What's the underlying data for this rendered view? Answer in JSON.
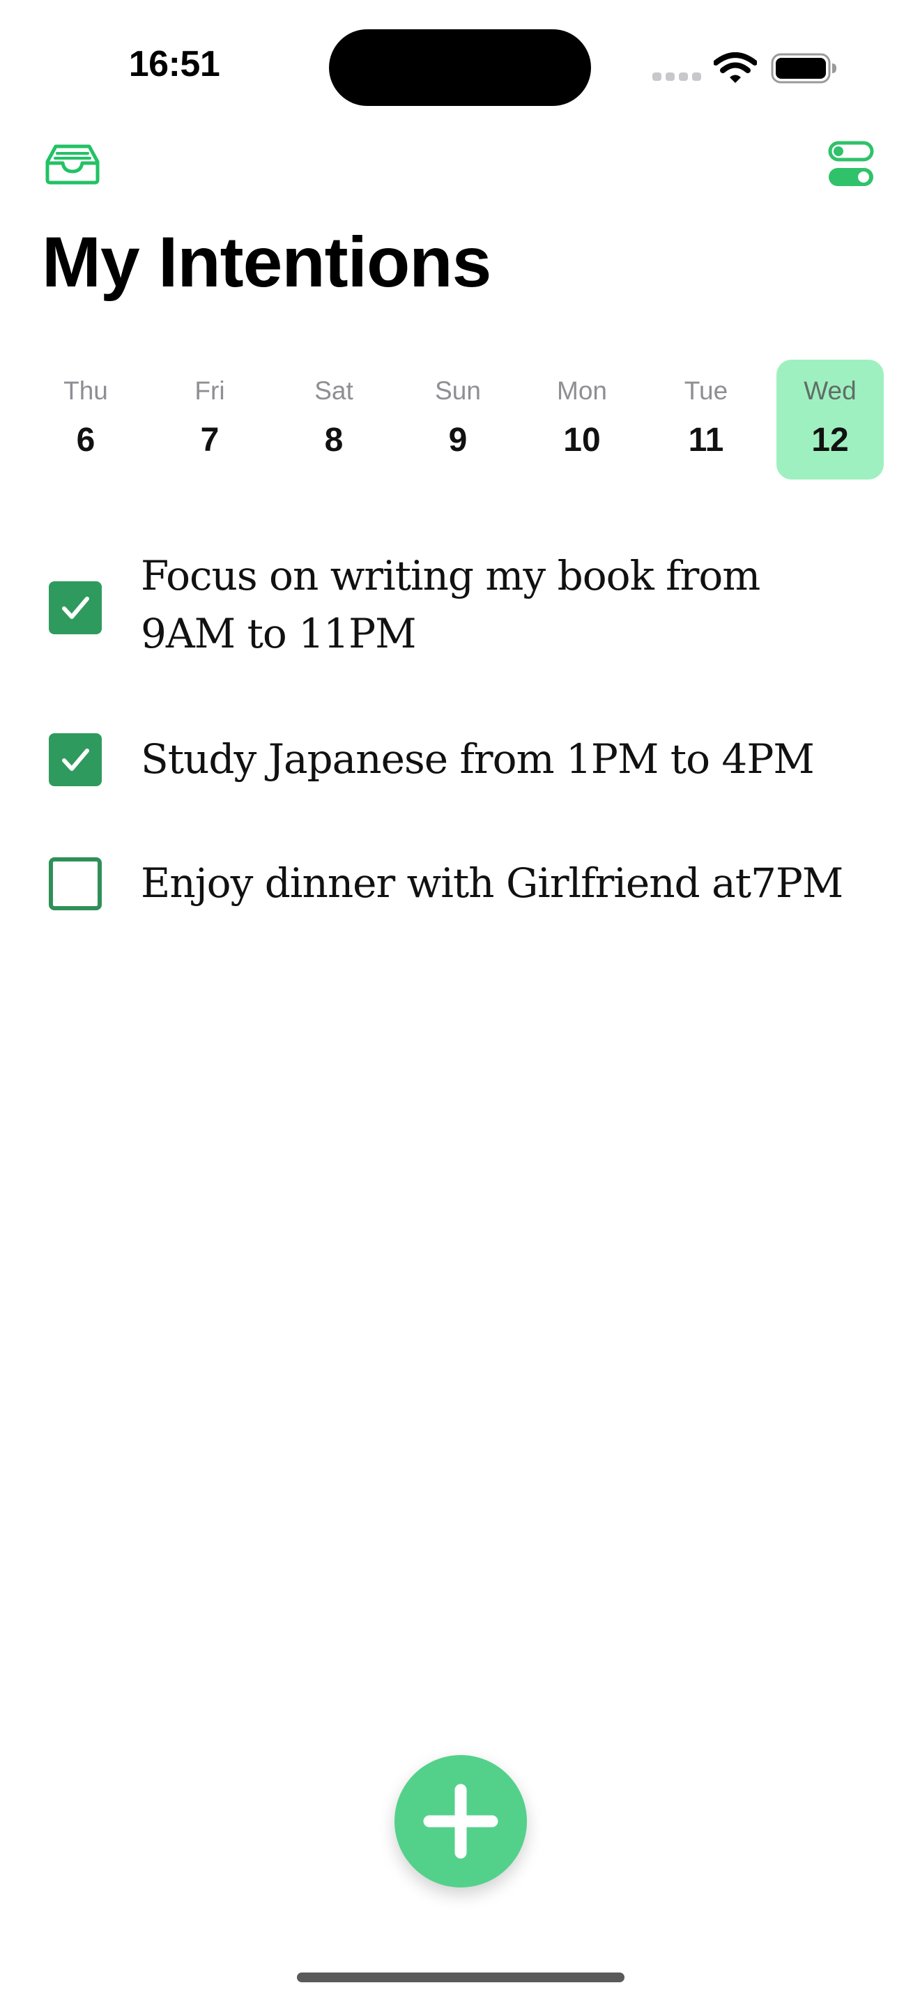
{
  "status_bar": {
    "time": "16:51",
    "icons": [
      "cellular-signal-icon",
      "wifi-icon",
      "battery-icon"
    ]
  },
  "header": {
    "inbox_icon": "inbox-tray-icon",
    "settings_icon": "toggle-switches-icon",
    "title": "My Intentions"
  },
  "week": {
    "days": [
      {
        "name": "Thu",
        "number": "6",
        "selected": false
      },
      {
        "name": "Fri",
        "number": "7",
        "selected": false
      },
      {
        "name": "Sat",
        "number": "8",
        "selected": false
      },
      {
        "name": "Sun",
        "number": "9",
        "selected": false
      },
      {
        "name": "Mon",
        "number": "10",
        "selected": false
      },
      {
        "name": "Tue",
        "number": "11",
        "selected": false
      },
      {
        "name": "Wed",
        "number": "12",
        "selected": true
      }
    ]
  },
  "tasks": [
    {
      "line1": "Focus on writing my book from",
      "line2": "9AM to 11PM",
      "checked": true
    },
    {
      "line1": "Study Japanese from 1PM to 4PM",
      "checked": true
    },
    {
      "line1": "Enjoy dinner with Girlfriend at7PM",
      "checked": false
    }
  ],
  "fab": {
    "icon": "plus-icon"
  },
  "colors": {
    "accent": "#2f9a5d",
    "accent_bright": "#2fc26a",
    "selected_day_bg": "#9ff0c0",
    "fab_bg": "#53d18a"
  }
}
